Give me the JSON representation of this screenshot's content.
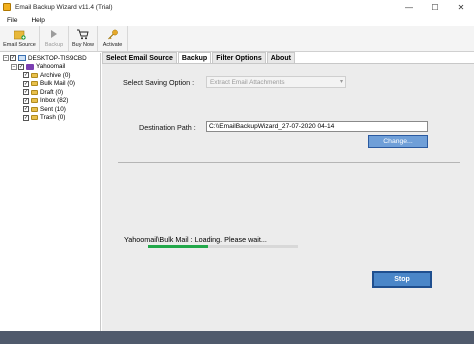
{
  "window": {
    "title": "Email Backup Wizard v11.4 (Trial)",
    "min": "—",
    "max": "☐",
    "close": "✕"
  },
  "menu": [
    "File",
    "Help"
  ],
  "toolbar": [
    {
      "label": "Email Source",
      "icon": "folder-add-icon",
      "enabled": true
    },
    {
      "label": "Backup",
      "icon": "play-icon",
      "enabled": false
    },
    {
      "label": "Buy Now",
      "icon": "cart-icon",
      "enabled": true
    },
    {
      "label": "Activate",
      "icon": "key-icon",
      "enabled": true
    }
  ],
  "tree": {
    "root": "DESKTOP-TIS9CBD",
    "account": "Yahoomail",
    "folders": [
      "Archive (0)",
      "Bulk Mail (0)",
      "Draft (0)",
      "Inbox (82)",
      "Sent (10)",
      "Trash (0)"
    ]
  },
  "tabs": [
    "Select Email Source",
    "Backup",
    "Filter Options",
    "About"
  ],
  "active_tab": "Backup",
  "backup": {
    "saving_option_label": "Select Saving Option :",
    "saving_option_value": "Extract Email Attachments",
    "destination_label": "Destination Path :",
    "destination_value": "C:\\\\EmailBackupWizard_27-07-2020 04-14",
    "change_button": "Change...",
    "status_text": "Yahoomail\\Bulk Mail : Loading. Please wait...",
    "progress": 0.4,
    "stop_button": "Stop"
  },
  "colors": {
    "progress": "#22a84a",
    "button": "#4a86c8",
    "status_bar": "#505a6c"
  }
}
